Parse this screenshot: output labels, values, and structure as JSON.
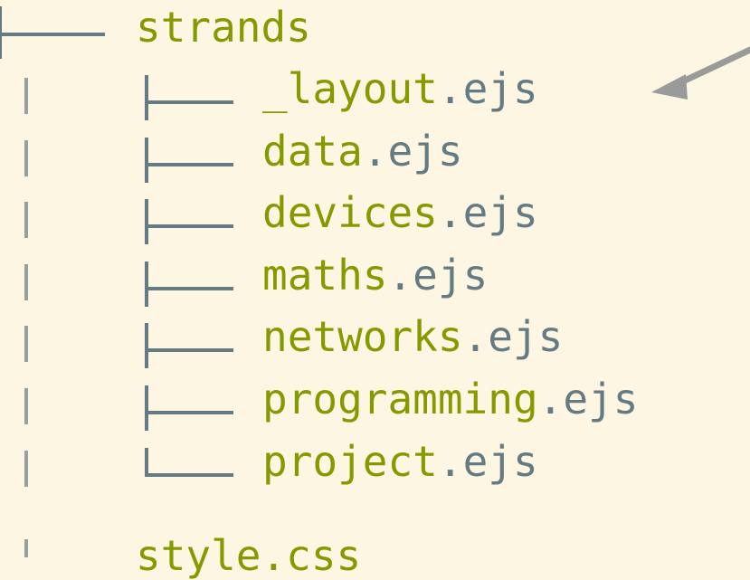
{
  "tree": {
    "directory": "strands",
    "files": [
      {
        "base": "_layout",
        "ext": ".ejs"
      },
      {
        "base": "data",
        "ext": ".ejs"
      },
      {
        "base": "devices",
        "ext": ".ejs"
      },
      {
        "base": "maths",
        "ext": ".ejs"
      },
      {
        "base": "networks",
        "ext": ".ejs"
      },
      {
        "base": "programming",
        "ext": ".ejs"
      },
      {
        "base": "project",
        "ext": ".ejs"
      }
    ],
    "partial_next": "style.css"
  },
  "annotation": {
    "arrow_target": "_layout.ejs",
    "arrow_color": "#999999"
  },
  "colors": {
    "background": "#fdf6e3",
    "name_green": "#859900",
    "ext_grey": "#657b83",
    "tree_lines": "#657b83"
  }
}
